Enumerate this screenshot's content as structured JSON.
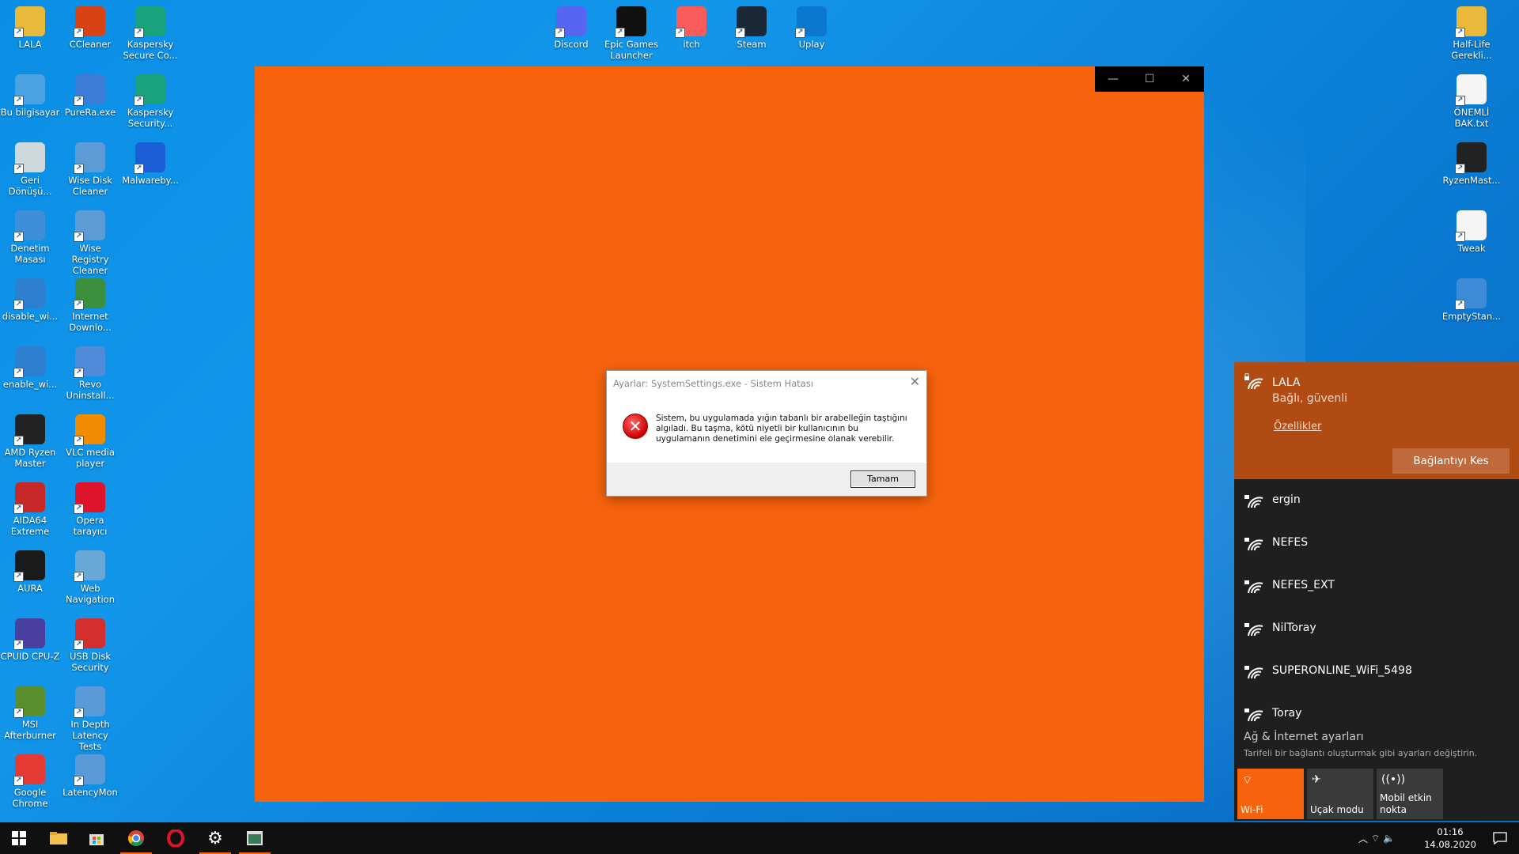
{
  "desktop": {
    "left_col1": [
      {
        "label": "LALA",
        "icon": "folder-icon",
        "color": "#e8b93a"
      },
      {
        "label": "Bu bilgisayar",
        "icon": "computer-icon",
        "color": "#4aa3e0"
      },
      {
        "label": "Geri Dönüşü...",
        "icon": "recycle-bin-icon",
        "color": "#cfd8dc"
      },
      {
        "label": "Denetim Masası",
        "icon": "control-panel-icon",
        "color": "#3f8fd8"
      },
      {
        "label": "disable_wi...",
        "icon": "script-icon",
        "color": "#2f7fd0"
      },
      {
        "label": "enable_wi...",
        "icon": "script-icon",
        "color": "#2f7fd0"
      },
      {
        "label": "AMD Ryzen Master",
        "icon": "ryzen-icon",
        "color": "#222222"
      },
      {
        "label": "AIDA64 Extreme",
        "icon": "aida64-icon",
        "color": "#c62828"
      },
      {
        "label": "AURA",
        "icon": "aura-icon",
        "color": "#1a1a1a"
      },
      {
        "label": "CPUID CPU-Z",
        "icon": "cpuz-icon",
        "color": "#4a3fa0"
      },
      {
        "label": "MSI Afterburner",
        "icon": "msi-afterburner-icon",
        "color": "#5b8f2e"
      },
      {
        "label": "Google Chrome",
        "icon": "chrome-icon",
        "color": "#e53935"
      }
    ],
    "left_col2": [
      {
        "label": "CCleaner",
        "icon": "ccleaner-icon",
        "color": "#d84315"
      },
      {
        "label": "PureRa.exe",
        "icon": "purera-icon",
        "color": "#3b7dd8"
      },
      {
        "label": "Wise Disk Cleaner",
        "icon": "wise-disk-cleaner-icon",
        "color": "#5c9bd6"
      },
      {
        "label": "Wise Registry Cleaner",
        "icon": "wise-registry-cleaner-icon",
        "color": "#5c9bd6"
      },
      {
        "label": "Internet Downlo...",
        "icon": "idm-icon",
        "color": "#3c8f3c"
      },
      {
        "label": "Revo Uninstall...",
        "icon": "revo-icon",
        "color": "#4f8bd6"
      },
      {
        "label": "VLC media player",
        "icon": "vlc-icon",
        "color": "#f08c00"
      },
      {
        "label": "Opera tarayıcı",
        "icon": "opera-icon",
        "color": "#e0132c"
      },
      {
        "label": "Web Navigation",
        "icon": "globe-icon",
        "color": "#6aa8d8"
      },
      {
        "label": "USB Disk Security",
        "icon": "usb-disk-security-icon",
        "color": "#d32f2f"
      },
      {
        "label": "In Depth Latency Tests",
        "icon": "latency-icon",
        "color": "#5a9ad8"
      },
      {
        "label": "LatencyMon",
        "icon": "latencymon-icon",
        "color": "#5a9ad8"
      }
    ],
    "left_col3": [
      {
        "label": "Kaspersky Secure Co...",
        "icon": "kaspersky-vpn-icon",
        "color": "#1aa37a"
      },
      {
        "label": "Kaspersky Security...",
        "icon": "kaspersky-icon",
        "color": "#1aa37a"
      },
      {
        "label": "Malwareby...",
        "icon": "malwarebytes-icon",
        "color": "#1a5fd6"
      }
    ],
    "top_row": [
      {
        "label": "Discord",
        "icon": "discord-icon",
        "color": "#5865f2"
      },
      {
        "label": "Epic Games Launcher",
        "icon": "epic-games-icon",
        "color": "#111111"
      },
      {
        "label": "itch",
        "icon": "itch-icon",
        "color": "#fa5c5c"
      },
      {
        "label": "Steam",
        "icon": "steam-icon",
        "color": "#1b2838"
      },
      {
        "label": "Uplay",
        "icon": "uplay-icon",
        "color": "#0b78d0"
      }
    ],
    "right_col": [
      {
        "label": "Half-Life Gerekli...",
        "icon": "folder-icon",
        "color": "#e8b93a"
      },
      {
        "label": "ÖNEMLİ BAK.txt",
        "icon": "text-file-icon",
        "color": "#f5f5f5"
      },
      {
        "label": "RyzenMast...",
        "icon": "ryzen-master-icon",
        "color": "#222222"
      },
      {
        "label": "Tweak",
        "icon": "document-icon",
        "color": "#f5f5f5"
      },
      {
        "label": "EmptyStan...",
        "icon": "emptystandby-icon",
        "color": "#3d8ad6"
      }
    ]
  },
  "app_window": {
    "min_label": "—",
    "max_label": "☐",
    "close_label": "✕"
  },
  "dialog": {
    "title": "Ayarlar: SystemSettings.exe - Sistem Hatası",
    "message": "Sistem, bu uygulamada yığın tabanlı bir arabelleğin taştığını algıladı. Bu taşma, kötü niyetli bir kullanıcının bu uygulamanın denetimini ele geçirmesine olanak verebilir.",
    "ok_label": "Tamam",
    "close_label": "✕",
    "error_glyph": "✕"
  },
  "network": {
    "connected": {
      "name": "LALA",
      "status": "Bağlı, güvenli",
      "properties_link": "Özellikler",
      "disconnect_label": "Bağlantıyı Kes"
    },
    "networks": [
      "ergin",
      "NEFES",
      "NEFES_EXT",
      "NilToray",
      "SUPERONLINE_WiFi_5498",
      "Toray"
    ],
    "settings_title": "Ağ & İnternet ayarları",
    "settings_desc": "Tarifeli bir bağlantı oluşturmak gibi ayarları değiştirin.",
    "tiles": {
      "wifi": "Wi-Fi",
      "airplane": "Uçak modu",
      "hotspot": "Mobil etkin nokta"
    },
    "accent": "#f7630c"
  },
  "taskbar": {
    "time": "01:16",
    "date": "14.08.2020"
  }
}
